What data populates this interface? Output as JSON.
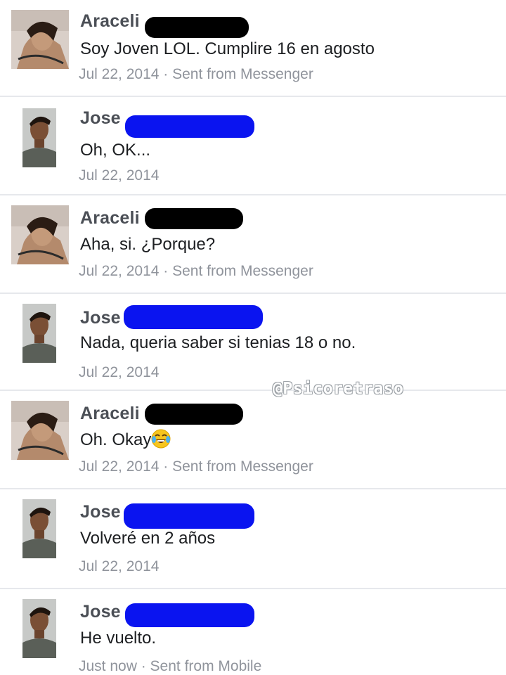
{
  "colors": {
    "sender": "#4b4f56",
    "message": "#1c1e21",
    "meta": "#90949c",
    "divider": "#e6e8ec",
    "redact_black": "#000000",
    "redact_blue": "#0a14f0"
  },
  "messages": [
    {
      "sender": "Araceli",
      "text": "Soy Joven LOL. Cumplire 16 en agosto",
      "meta": "Jul 22, 2014 · Sent from Messenger"
    },
    {
      "sender": "Jose",
      "text": "Oh, OK...",
      "meta": "Jul 22, 2014"
    },
    {
      "sender": "Araceli",
      "text": "Aha, si. ¿Porque?",
      "meta": "Jul 22, 2014 · Sent from Messenger"
    },
    {
      "sender": "Jose",
      "text": "Nada, queria saber si tenias 18 o no.",
      "meta": "Jul 22, 2014"
    },
    {
      "sender": "Araceli",
      "text": "Oh. Okay",
      "emoji": "laughing-tears-emoji",
      "meta": "Jul 22, 2014 · Sent from Messenger"
    },
    {
      "sender": "Jose",
      "text": "Volveré en 2 años",
      "meta": "Jul 22, 2014"
    },
    {
      "sender": "Jose",
      "text": "He vuelto.",
      "meta": "Just now · Sent from Mobile"
    }
  ],
  "watermark": "@Psicoretraso"
}
